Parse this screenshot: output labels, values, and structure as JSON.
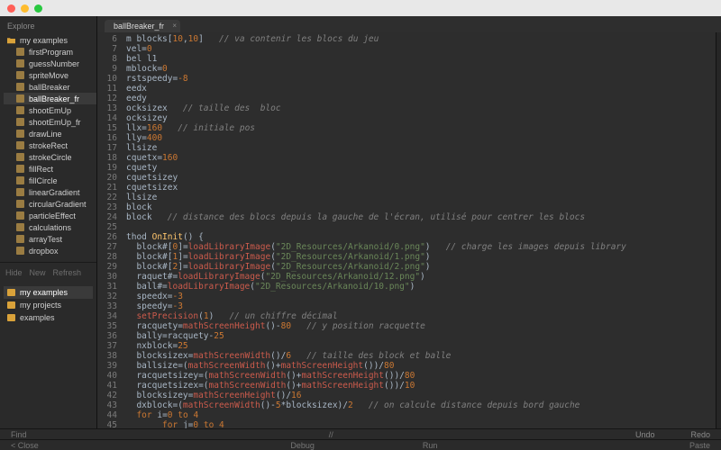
{
  "sidebar": {
    "panel_title": "Explore",
    "folder_label": "my examples",
    "files": [
      "firstProgram",
      "guessNumber",
      "spriteMove",
      "ballBreaker",
      "ballBreaker_fr",
      "shootEmUp",
      "shootEmUp_fr",
      "drawLine",
      "strokeRect",
      "strokeCircle",
      "fillRect",
      "fillCircle",
      "linearGradient",
      "circularGradient",
      "particleEffect",
      "calculations",
      "arrayTest",
      "dropbox"
    ],
    "selected_file_index": 4,
    "actions": [
      "Hide",
      "New",
      "Refresh"
    ],
    "projects": [
      "my examples",
      "my projects",
      "examples"
    ],
    "selected_project_index": 0
  },
  "tab": {
    "label": "ballBreaker_fr"
  },
  "editor": {
    "first_line_no": 6,
    "lines": [
      [
        [
          "id",
          "m blocks["
        ],
        [
          "num",
          "10"
        ],
        [
          "op",
          ","
        ],
        [
          "num",
          "10"
        ],
        [
          "id",
          "]   "
        ],
        [
          "cmt",
          "// va contenir les blocs du jeu"
        ]
      ],
      [
        [
          "id",
          "vel="
        ],
        [
          "num",
          "0"
        ]
      ],
      [
        [
          "id",
          "bel l1"
        ]
      ],
      [
        [
          "id",
          "mblock="
        ],
        [
          "num",
          "0"
        ]
      ],
      [
        [
          "id",
          "rstspeedy="
        ],
        [
          "num",
          "-8"
        ]
      ],
      [
        [
          "id",
          "eedx"
        ]
      ],
      [
        [
          "id",
          "eedy"
        ]
      ],
      [
        [
          "id",
          "ocksizex   "
        ],
        [
          "cmt",
          "// taille des  bloc"
        ]
      ],
      [
        [
          "id",
          "ocksizey"
        ]
      ],
      [
        [
          "id",
          "llx="
        ],
        [
          "num",
          "160"
        ],
        [
          "id",
          "   "
        ],
        [
          "cmt",
          "// initiale pos"
        ]
      ],
      [
        [
          "id",
          "lly="
        ],
        [
          "num",
          "400"
        ]
      ],
      [
        [
          "id",
          "llsize"
        ]
      ],
      [
        [
          "id",
          "cquetx="
        ],
        [
          "num",
          "160"
        ]
      ],
      [
        [
          "id",
          "cquety"
        ]
      ],
      [
        [
          "id",
          "cquetsizey"
        ]
      ],
      [
        [
          "id",
          "cquetsizex"
        ]
      ],
      [
        [
          "id",
          "llsize"
        ]
      ],
      [
        [
          "id",
          "block"
        ]
      ],
      [
        [
          "id",
          "block   "
        ],
        [
          "cmt",
          "// distance des blocs depuis la gauche de l'écran, utilisé pour centrer les blocs"
        ]
      ],
      [],
      [
        [
          "id",
          "thod "
        ],
        [
          "fn",
          "OnInit"
        ],
        [
          "id",
          "() {"
        ]
      ],
      [
        [
          "id",
          "  block#["
        ],
        [
          "idnum",
          "0"
        ],
        [
          "id",
          "]="
        ],
        [
          "call",
          "loadLibraryImage"
        ],
        [
          "id",
          "("
        ],
        [
          "str",
          "\"2D_Resources/Arkanoid/0.png\""
        ],
        [
          "id",
          ")   "
        ],
        [
          "cmt",
          "// charge les images depuis library"
        ]
      ],
      [
        [
          "id",
          "  block#["
        ],
        [
          "idnum",
          "1"
        ],
        [
          "id",
          "]="
        ],
        [
          "call",
          "loadLibraryImage"
        ],
        [
          "id",
          "("
        ],
        [
          "str",
          "\"2D_Resources/Arkanoid/1.png\""
        ],
        [
          "id",
          ")"
        ]
      ],
      [
        [
          "id",
          "  block#["
        ],
        [
          "idnum",
          "2"
        ],
        [
          "id",
          "]="
        ],
        [
          "call",
          "loadLibraryImage"
        ],
        [
          "id",
          "("
        ],
        [
          "str",
          "\"2D_Resources/Arkanoid/2.png\""
        ],
        [
          "id",
          ")"
        ]
      ],
      [
        [
          "id",
          "  raquet#="
        ],
        [
          "call",
          "loadLibraryImage"
        ],
        [
          "id",
          "("
        ],
        [
          "str",
          "\"2D_Resources/Arkanoid/12.png\""
        ],
        [
          "id",
          ")"
        ]
      ],
      [
        [
          "id",
          "  ball#="
        ],
        [
          "call",
          "loadLibraryImage"
        ],
        [
          "id",
          "("
        ],
        [
          "str",
          "\"2D_Resources/Arkanoid/10.png\""
        ],
        [
          "id",
          ")"
        ]
      ],
      [
        [
          "id",
          "  speedx="
        ],
        [
          "num",
          "-3"
        ]
      ],
      [
        [
          "id",
          "  speedy="
        ],
        [
          "num",
          "-3"
        ]
      ],
      [
        [
          "id",
          "  "
        ],
        [
          "call",
          "setPrecision"
        ],
        [
          "id",
          "("
        ],
        [
          "num",
          "1"
        ],
        [
          "id",
          ")   "
        ],
        [
          "cmt",
          "// un chiffre décimal"
        ]
      ],
      [
        [
          "id",
          "  racquety="
        ],
        [
          "call",
          "mathScreenHeight"
        ],
        [
          "id",
          "()-"
        ],
        [
          "num",
          "80"
        ],
        [
          "id",
          "   "
        ],
        [
          "cmt",
          "// y position racquette"
        ]
      ],
      [
        [
          "id",
          "  bally=racquety-"
        ],
        [
          "num",
          "25"
        ]
      ],
      [
        [
          "id",
          "  nxblock="
        ],
        [
          "num",
          "25"
        ]
      ],
      [
        [
          "id",
          "  blocksizex="
        ],
        [
          "call",
          "mathScreenWidth"
        ],
        [
          "id",
          "()/"
        ],
        [
          "num",
          "6"
        ],
        [
          "id",
          "   "
        ],
        [
          "cmt",
          "// taille des block et balle"
        ]
      ],
      [
        [
          "id",
          "  ballsize=("
        ],
        [
          "call",
          "mathScreenWidth"
        ],
        [
          "id",
          "()+"
        ],
        [
          "call",
          "mathScreenHeight"
        ],
        [
          "id",
          "())/"
        ],
        [
          "num",
          "80"
        ]
      ],
      [
        [
          "id",
          "  racquetsizey=("
        ],
        [
          "call",
          "mathScreenWidth"
        ],
        [
          "id",
          "()+"
        ],
        [
          "call",
          "mathScreenHeight"
        ],
        [
          "id",
          "())/"
        ],
        [
          "num",
          "80"
        ]
      ],
      [
        [
          "id",
          "  racquetsizex=("
        ],
        [
          "call",
          "mathScreenWidth"
        ],
        [
          "id",
          "()+"
        ],
        [
          "call",
          "mathScreenHeight"
        ],
        [
          "id",
          "())/"
        ],
        [
          "num",
          "10"
        ]
      ],
      [
        [
          "id",
          "  blocksizey="
        ],
        [
          "call",
          "mathScreenHeight"
        ],
        [
          "id",
          "()/"
        ],
        [
          "num",
          "16"
        ]
      ],
      [
        [
          "id",
          "  dxblock=("
        ],
        [
          "call",
          "mathScreenWidth"
        ],
        [
          "id",
          "()-"
        ],
        [
          "num",
          "5"
        ],
        [
          "id",
          "*blocksizex)/"
        ],
        [
          "num",
          "2"
        ],
        [
          "id",
          "   "
        ],
        [
          "cmt",
          "// on calcule distance depuis bord gauche"
        ]
      ],
      [
        [
          "id",
          "  "
        ],
        [
          "kw",
          "for"
        ],
        [
          "id",
          " i="
        ],
        [
          "num",
          "0"
        ],
        [
          "id",
          " "
        ],
        [
          "kw",
          "to"
        ],
        [
          "id",
          " "
        ],
        [
          "num",
          "4"
        ]
      ],
      [
        [
          "id",
          "       "
        ],
        [
          "kw",
          "for"
        ],
        [
          "id",
          " j="
        ],
        [
          "num",
          "0"
        ],
        [
          "id",
          " "
        ],
        [
          "kw",
          "to"
        ],
        [
          "id",
          " "
        ],
        [
          "num",
          "4"
        ]
      ]
    ]
  },
  "cmdbar": {
    "left": "Find",
    "mid": "//",
    "right_a": "Undo",
    "right_b": "Redo"
  },
  "statusbar": {
    "left": "< Close",
    "mid_a": "Debug",
    "mid_b": "Run",
    "right": "Paste"
  }
}
